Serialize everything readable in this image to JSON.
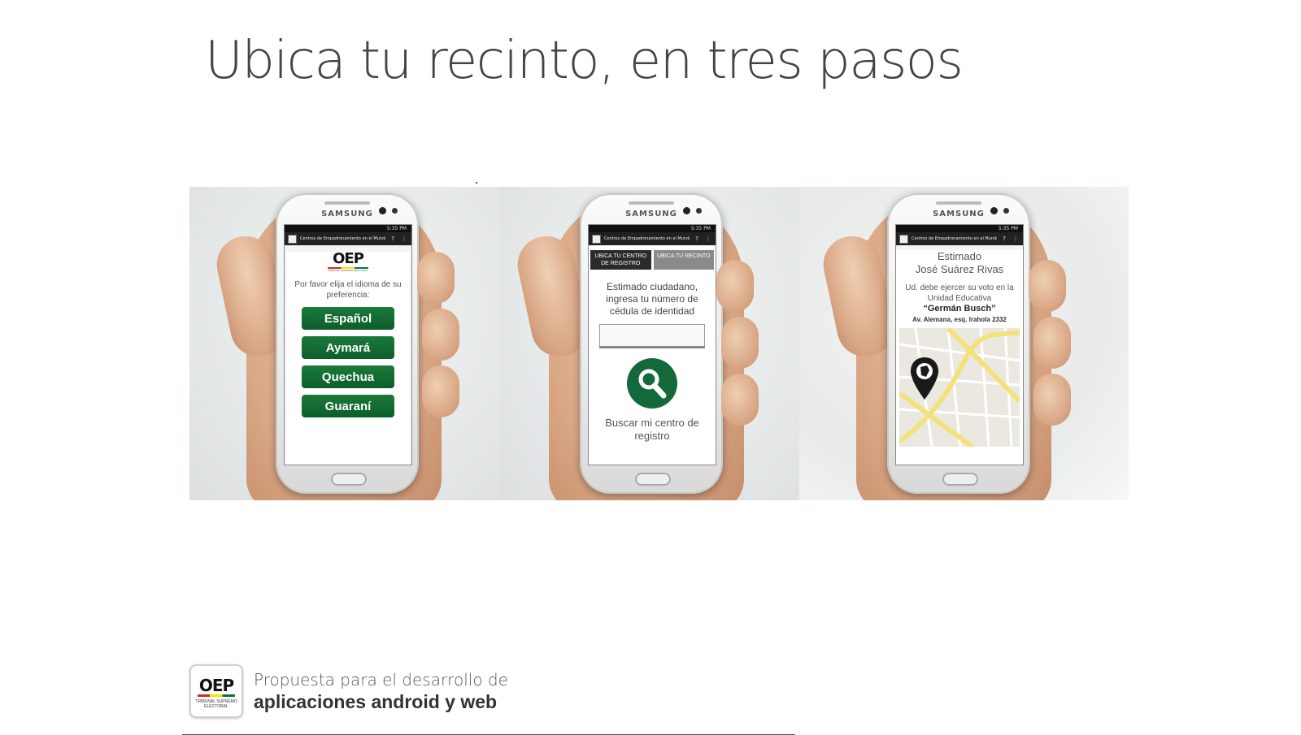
{
  "headline": "Ubica tu recinto, en tres pasos",
  "phone": {
    "brand": "SAMSUNG",
    "status_time": "5:35 PM",
    "app_title": "Centros de Empadronamiento en el Mundo",
    "help_icon": "question-icon",
    "menu_icon": "overflow-menu-icon"
  },
  "step1": {
    "logo_text": "OEP",
    "logo_sub": "TRIBUNAL SUPREMO ELECTORAL",
    "prompt": "Por favor elija el idioma de su preferencia:",
    "languages": [
      "Español",
      "Aymará",
      "Quechua",
      "Guaraní"
    ]
  },
  "step2": {
    "tab_active": "UBICA TU CENTRO DE REGISTRO",
    "tab_inactive": "UBICA TU RECINTO",
    "instructions": "Estimado ciudadano, ingresa tu número de cédula de identidad",
    "input_value": "",
    "search_icon": "search-icon",
    "search_caption": "Buscar mi centro de registro"
  },
  "step3": {
    "greeting": "Estimado",
    "name": "José Suárez Rivas",
    "message": "Ud. debe ejercer su voto en la Unidad Educativa",
    "school": "“Germán Busch”",
    "address": "Av. Alemana, esq. Irahola 2332",
    "pin_icon": "map-pin-icon"
  },
  "footer": {
    "logo_text": "OEP",
    "logo_sub": "TRIBUNAL SUPREMO ELECTORAL",
    "line1": "Propuesta para el desarrollo de",
    "line2": "aplicaciones android y web"
  },
  "colors": {
    "button_green": "#0c5e2a",
    "flag_red": "#d52b1e",
    "flag_yellow": "#f9e300",
    "flag_green": "#007934"
  }
}
